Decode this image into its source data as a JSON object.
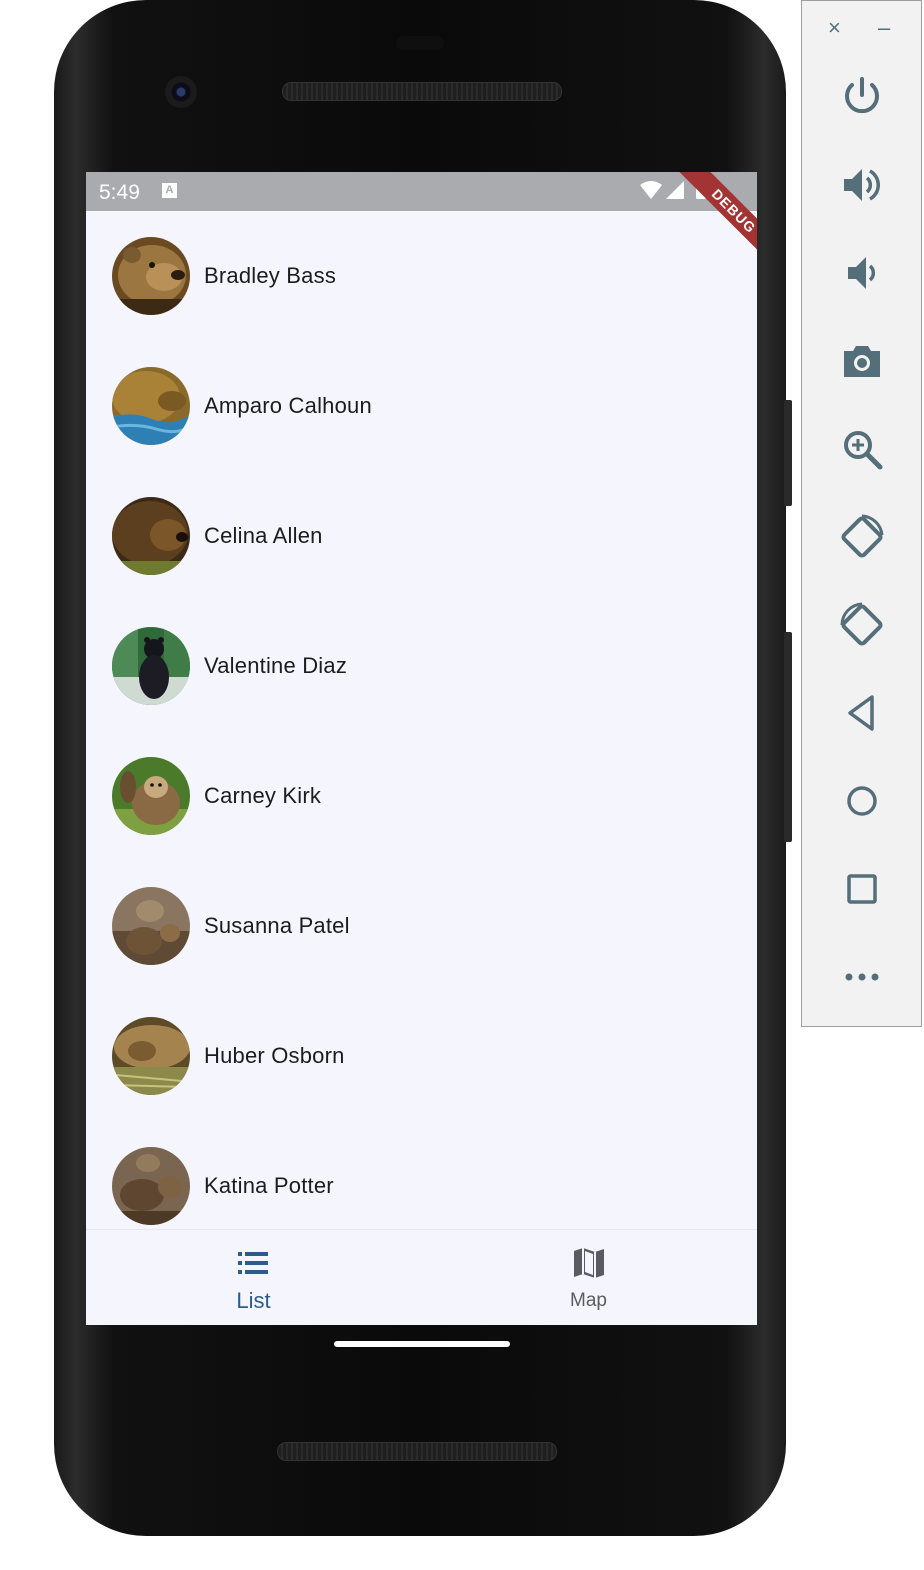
{
  "status_bar": {
    "time": "5:49",
    "notification_badge": "A",
    "icons": [
      "wifi-icon",
      "cell-signal-icon",
      "battery-icon"
    ],
    "debug_banner": "DEBUG",
    "color": "#a9abaf"
  },
  "list": {
    "items": [
      {
        "name": "Bradley Bass",
        "avatar": "brown-bear-photo"
      },
      {
        "name": "Amparo Calhoun",
        "avatar": "bear-in-water-photo"
      },
      {
        "name": "Celina Allen",
        "avatar": "brown-bear-photo"
      },
      {
        "name": "Valentine Diaz",
        "avatar": "black-bear-photo"
      },
      {
        "name": "Carney Kirk",
        "avatar": "bear-waving-photo"
      },
      {
        "name": "Susanna Patel",
        "avatar": "bear-cubs-photo"
      },
      {
        "name": "Huber Osborn",
        "avatar": "bear-resting-photo"
      },
      {
        "name": "Katina Potter",
        "avatar": "bear-cubs-photo"
      }
    ]
  },
  "bottom_nav": {
    "items": [
      {
        "label": "List",
        "icon": "list-icon",
        "selected": true
      },
      {
        "label": "Map",
        "icon": "map-icon",
        "selected": false
      }
    ],
    "selected_color": "#2b5c8e",
    "unselected_color": "#5a5a60"
  },
  "emulator_panel": {
    "close": "×",
    "minimize": "–",
    "buttons": [
      "power-icon",
      "volume-up-icon",
      "volume-down-icon",
      "camera-icon",
      "zoom-icon",
      "rotate-left-icon",
      "rotate-right-icon",
      "back-icon",
      "home-icon",
      "overview-icon",
      "more-icon"
    ],
    "icon_color": "#546e7a"
  }
}
